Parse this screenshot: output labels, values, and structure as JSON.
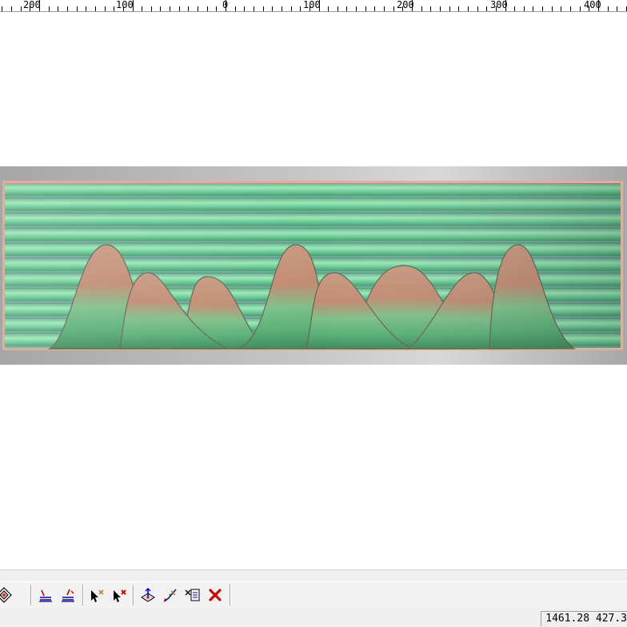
{
  "ruler": {
    "labels": [
      "200",
      "100",
      "0",
      "100",
      "200",
      "300",
      "400"
    ]
  },
  "colors": {
    "frame": "#b9b9b9",
    "panel_green": "#6ccf98",
    "mountain_peak": "#c7947c",
    "close_red": "#cc0000"
  },
  "toolbar": {
    "icons": [
      "diamond-node-icon",
      "layers-icon",
      "layers-edit-icon",
      "select-cross-icon",
      "delete-select-icon",
      "transform-icon",
      "edit-curve-icon",
      "edit-list-icon",
      "close-icon"
    ]
  },
  "status": {
    "coordinates": "1461.28 427.3"
  }
}
